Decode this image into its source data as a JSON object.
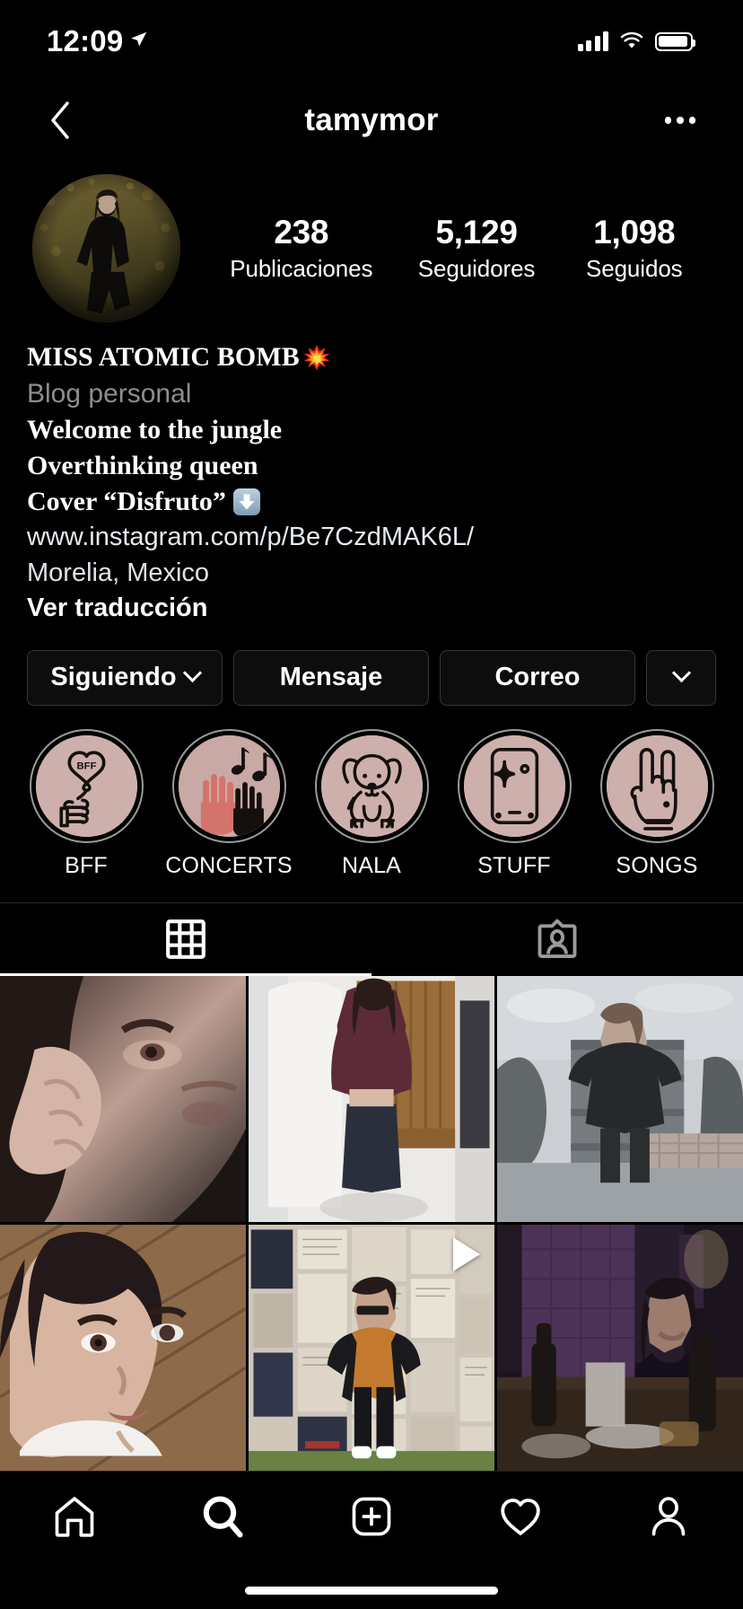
{
  "status_bar": {
    "time": "12:09",
    "location_icon": "location-arrow-icon",
    "signal_icon": "cellular-bars-icon",
    "wifi_icon": "wifi-icon",
    "battery_icon": "battery-full-icon"
  },
  "nav": {
    "back_icon": "chevron-left-icon",
    "title": "tamymor",
    "more_icon": "ellipsis-icon"
  },
  "profile": {
    "avatar_alt": "profile-photo",
    "stats": [
      {
        "value": "238",
        "label": "Publicaciones"
      },
      {
        "value": "5,129",
        "label": "Seguidores"
      },
      {
        "value": "1,098",
        "label": "Seguidos"
      }
    ],
    "bio": {
      "display_name": "MISS ATOMIC BOMB",
      "display_name_emoji": "collision-emoji",
      "category": "Blog personal",
      "line1": "Welcome to the jungle",
      "line2": "Overthinking queen",
      "line3": "Cover “Disfruto”",
      "line3_emoji": "arrow-down-button-emoji",
      "website": "www.instagram.com/p/Be7CzdMAK6L/",
      "location": "Morelia, Mexico",
      "translate": "Ver traducción"
    }
  },
  "actions": {
    "follow": "Siguiendo",
    "follow_caret_icon": "chevron-down-icon",
    "message": "Mensaje",
    "email": "Correo",
    "more_caret_icon": "chevron-down-icon"
  },
  "highlights": [
    {
      "label": "BFF",
      "icon": "bff-balloon-icon"
    },
    {
      "label": "CONCERTS",
      "icon": "hands-music-notes-icon"
    },
    {
      "label": "NALA",
      "icon": "dog-icon"
    },
    {
      "label": "STUFF",
      "icon": "phone-sparkle-icon"
    },
    {
      "label": "SONGS",
      "icon": "rock-on-hand-icon"
    }
  ],
  "tabs": [
    {
      "name": "grid",
      "icon": "grid-icon",
      "active": true
    },
    {
      "name": "tagged",
      "icon": "tagged-person-icon",
      "active": false
    }
  ],
  "grid_posts": [
    {
      "id": "post-1",
      "alt": "close-up-selfie-hand-on-face",
      "is_video": false
    },
    {
      "id": "post-2",
      "alt": "mirror-selfie-burgundy-top",
      "is_video": false
    },
    {
      "id": "post-3",
      "alt": "black-white-outdoor-portrait",
      "is_video": false
    },
    {
      "id": "post-4",
      "alt": "selfie-lying-down",
      "is_video": false
    },
    {
      "id": "post-5",
      "alt": "poster-wall-street-photo",
      "is_video": true
    },
    {
      "id": "post-6",
      "alt": "dim-bar-purple-light-photo",
      "is_video": false
    }
  ],
  "bottom_nav": [
    {
      "name": "home",
      "icon": "home-icon",
      "active": false
    },
    {
      "name": "search",
      "icon": "search-icon",
      "active": true
    },
    {
      "name": "create",
      "icon": "plus-square-icon",
      "active": false
    },
    {
      "name": "activity",
      "icon": "heart-icon",
      "active": false
    },
    {
      "name": "profile",
      "icon": "person-icon",
      "active": false
    }
  ],
  "colors": {
    "background": "#000000",
    "highlight_cover": "#cdb0ac",
    "secondary_text": "#8e8e8e",
    "border": "#363636"
  }
}
